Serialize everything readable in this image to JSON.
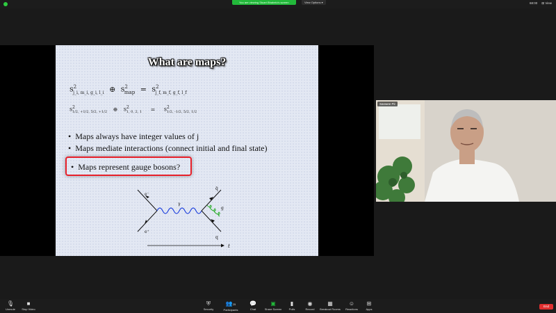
{
  "topbar": {
    "share_banner": "You are viewing Stuart Bhabelo's screen",
    "view_options": "View Options ▾",
    "time": "68:00",
    "view": "⊞ View"
  },
  "slide": {
    "title": "What are maps?",
    "eq1": {
      "base1": "s",
      "sup1": "2",
      "sub1": "j_i, m_i, g_i, l_i",
      "op": "⊕",
      "base2": "s",
      "sup2": "2",
      "sub2": "map",
      "eqsign": "=",
      "base3": "s",
      "sup3": "2",
      "sub3": "j_f, m_f, g_f, l_f"
    },
    "eq2": {
      "base1": "s",
      "sup1": "2",
      "sub1": "1/2, +1/2, 5/2, +1/2",
      "op": "⊕",
      "base2": "s",
      "sup2": "2",
      "sub2": "1, 0, 2, 1",
      "eqsign": "=",
      "base3": "s",
      "sup3": "2",
      "sub3": "1/2, -1/2, 5/2, 1/2"
    },
    "bullets": [
      "Maps always have integer values of j",
      "Maps mediate interactions (connect initial and final state)"
    ],
    "highlighted_bullet": "Maps represent gauge bosons?",
    "diagram": {
      "e_minus": "e⁻",
      "e_plus": "e⁺",
      "gamma": "γ",
      "qbar": "q̄",
      "q": "q",
      "g": "g",
      "t": "t"
    }
  },
  "video": {
    "name": "Sanwee Pir"
  },
  "toolbar": {
    "unmute": "Unmute",
    "stop_video": "Stop Video",
    "security": "Security",
    "participants": "Participants",
    "participants_count": "25",
    "chat": "Chat",
    "share_screen": "Share Screen",
    "polls": "Polls",
    "record": "Record",
    "breakout": "Breakout Rooms",
    "reactions": "Reactions",
    "apps": "Apps",
    "end": "End"
  },
  "colors": {
    "share_green": "#22b83a",
    "highlight_red": "#e8202a",
    "end_red": "#e02f2f",
    "photon_blue": "#2244dd",
    "gluon_green": "#22aa22"
  }
}
